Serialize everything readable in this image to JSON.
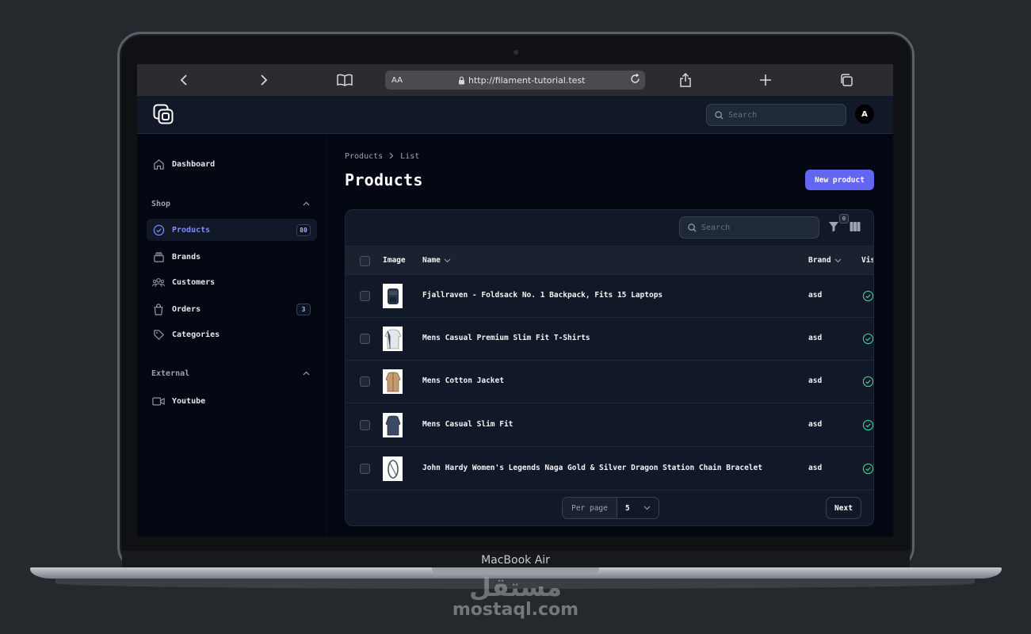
{
  "browser": {
    "text_size_label": "AA",
    "url": "http://filament-tutorial.test",
    "back_icon": "chevron-left-icon",
    "forward_icon": "chevron-right-icon"
  },
  "device": {
    "model_label": "MacBook Air"
  },
  "watermark": {
    "arabic": "مستقل",
    "site": "mostaql.com"
  },
  "header": {
    "search_placeholder": "Search",
    "avatar_initial": "A"
  },
  "sidebar": {
    "dashboard": "Dashboard",
    "groups": [
      {
        "label": "Shop",
        "items": [
          {
            "label": "Products",
            "badge": "80",
            "active": true
          },
          {
            "label": "Brands"
          },
          {
            "label": "Customers"
          },
          {
            "label": "Orders",
            "badge": "3"
          },
          {
            "label": "Categories"
          }
        ]
      },
      {
        "label": "External",
        "items": [
          {
            "label": "Youtube"
          }
        ]
      }
    ]
  },
  "page": {
    "breadcrumb": [
      "Products",
      "List"
    ],
    "title": "Products",
    "new_button": "New product"
  },
  "table": {
    "search_placeholder": "Search",
    "filter_count": "0",
    "columns": [
      "Image",
      "Name",
      "Brand",
      "Vis"
    ],
    "rows": [
      {
        "name": "Fjallraven - Foldsack No. 1 Backpack, Fits 15 Laptops",
        "brand": "asd",
        "visible": true
      },
      {
        "name": "Mens Casual Premium Slim Fit T-Shirts",
        "brand": "asd",
        "visible": true
      },
      {
        "name": "Mens Cotton Jacket",
        "brand": "asd",
        "visible": true
      },
      {
        "name": "Mens Casual Slim Fit",
        "brand": "asd",
        "visible": true
      },
      {
        "name": "John Hardy Women's Legends Naga Gold & Silver Dragon Station Chain Bracelet",
        "brand": "asd",
        "visible": true
      }
    ],
    "per_page_label": "Per page",
    "per_page_value": "5",
    "next_label": "Next"
  },
  "colors": {
    "accent": "#6366f1",
    "active_nav": "#818cf8",
    "success": "#34d399",
    "background": "#030712",
    "surface": "#111827"
  }
}
